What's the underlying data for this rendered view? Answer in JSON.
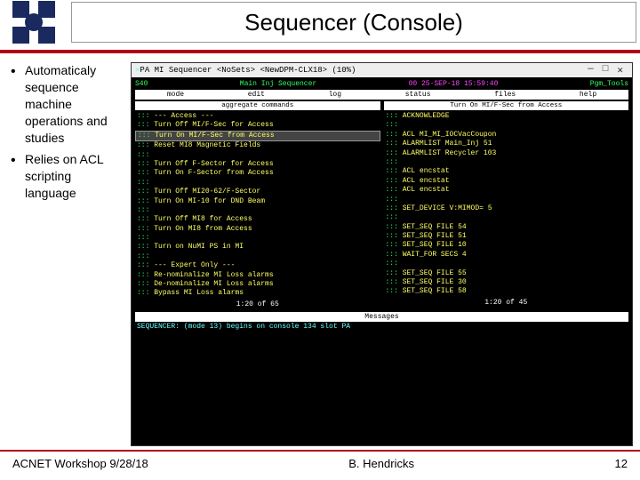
{
  "slide": {
    "title": "Sequencer (Console)",
    "bullets": [
      "Automaticaly sequence machine operations and studies",
      "Relies on ACL scripting language"
    ]
  },
  "window": {
    "title": "PA MI Sequencer <NoSets> <NewDPM-CLX18> (10%)",
    "min": "—",
    "max": "□",
    "close": "✕"
  },
  "terminal": {
    "app_id": "S40",
    "app_name": "Main Inj Sequencer",
    "clock": "00 25-SEP-18 15:59:40",
    "tool_hint": "Pgm_Tools",
    "menu": [
      "mode",
      "edit",
      "log",
      "status",
      "files",
      "help"
    ],
    "left_pane": {
      "title": "aggregate commands",
      "lines": [
        ":::  --- Access ---",
        ":::  Turn Off MI/F-Sec for Access",
        ":::  Turn On MI/F-Sec from Access",
        ":::  Reset MI8 Magnetic Fields",
        ":::  ",
        ":::  Turn Off F-Sector for Access",
        ":::  Turn On F-Sector from Access",
        ":::  ",
        ":::  Turn Off MI20-62/F-Sector",
        ":::  Turn On MI-10 for DND Beam",
        ":::  ",
        ":::  Turn Off MI8 for Access",
        ":::  Turn On MI8 from Access",
        ":::  ",
        ":::  Turn on NuMI PS in MI",
        ":::  ",
        ":::  --- Expert Only ---",
        ":::  Re-nominalize MI Loss alarms",
        ":::  De-nominalize MI Loss alarms",
        ":::  Bypass MI Loss alarms"
      ],
      "counter": "1:20 of 65",
      "selected_index": 2
    },
    "right_pane": {
      "title": "Turn On MI/F-Sec from Access",
      "lines": [
        ":::  ACKNOWLEDGE",
        ":::  ",
        ":::  ACL MI_MI_IOCVacCoupon",
        ":::  ALARMLIST Main_Inj 51",
        ":::  ALARMLIST Recycler 103",
        ":::  ",
        ":::  ACL encstat",
        ":::  ACL encstat",
        ":::  ACL encstat",
        ":::  ",
        ":::  SET_DEVICE V:MIMOD= 5",
        ":::  ",
        ":::  SET_SEQ FILE 54",
        ":::  SET_SEQ FILE 51",
        ":::  SET_SEQ FILE 10",
        ":::  WAIT_FOR SECS 4",
        ":::  ",
        ":::  SET_SEQ FILE 55",
        ":::  SET_SEQ FILE 30",
        ":::  SET_SEQ FILE 58"
      ],
      "counter": "1:20 of 45"
    },
    "msg_title": "Messages",
    "msg_line": "SEQUENCER: (mode 13) begins on console 134 slot PA"
  },
  "footer": {
    "left": "ACNET Workshop 9/28/18",
    "center": "B. Hendricks",
    "right": "12"
  }
}
